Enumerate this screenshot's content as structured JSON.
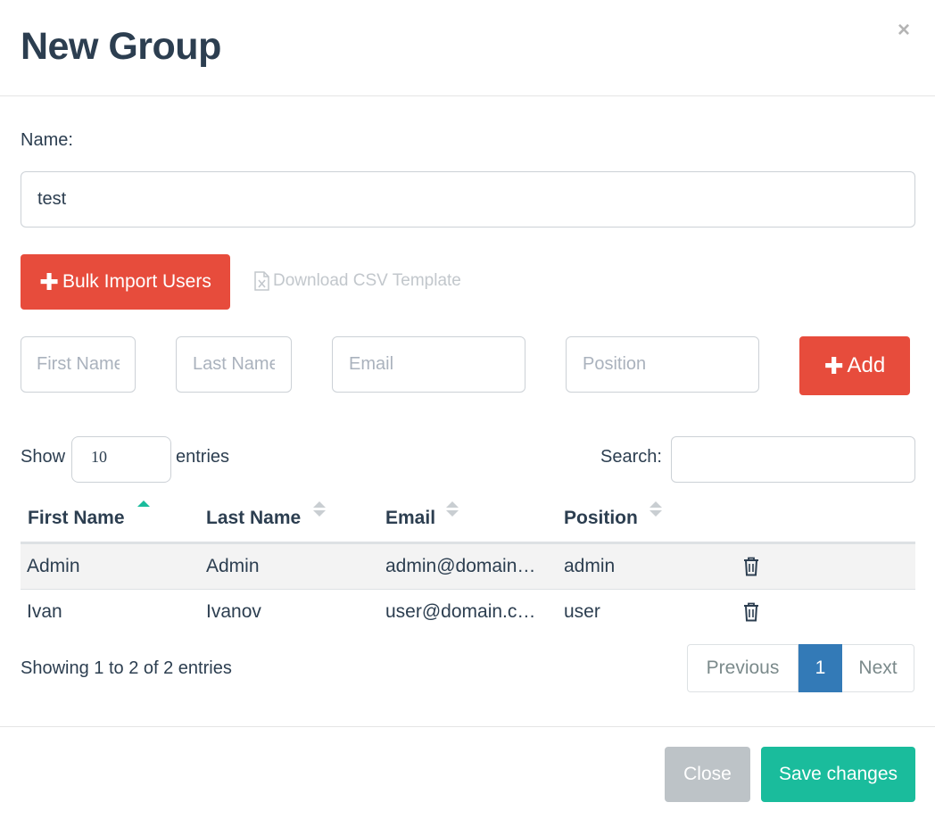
{
  "modal": {
    "title": "New Group",
    "close_glyph": "×"
  },
  "name_field": {
    "label": "Name:",
    "value": "test"
  },
  "bulk_import": {
    "label": "Bulk Import Users",
    "icon": "plus-icon"
  },
  "csv_template": {
    "label": "Download CSV Template",
    "icon": "file-excel-icon"
  },
  "add_user_form": {
    "first_name_placeholder": "First Name",
    "last_name_placeholder": "Last Name",
    "email_placeholder": "Email",
    "position_placeholder": "Position",
    "add_label": "Add"
  },
  "table_controls": {
    "show_label": "Show",
    "entries_value": "10",
    "entries_label": "entries",
    "search_label": "Search:",
    "search_value": ""
  },
  "table": {
    "columns": [
      "First Name",
      "Last Name",
      "Email",
      "Position"
    ],
    "sorted_column": "First Name",
    "sort_direction": "ascending",
    "rows": [
      {
        "first_name": "Admin",
        "last_name": "Admin",
        "email": "admin@domain…",
        "position": "admin"
      },
      {
        "first_name": "Ivan",
        "last_name": "Ivanov",
        "email": "user@domain.c…",
        "position": "user"
      }
    ]
  },
  "pagination": {
    "info": "Showing 1 to 2 of 2 entries",
    "previous": "Previous",
    "current_page": "1",
    "next": "Next"
  },
  "footer": {
    "close_label": "Close",
    "save_label": "Save changes"
  },
  "colors": {
    "primary_text": "#2c3e50",
    "danger": "#e74c3c",
    "success": "#1abc9c",
    "page_active": "#337ab7",
    "sort_active": "#1abc9c",
    "close_button": "#bdc3c7"
  }
}
